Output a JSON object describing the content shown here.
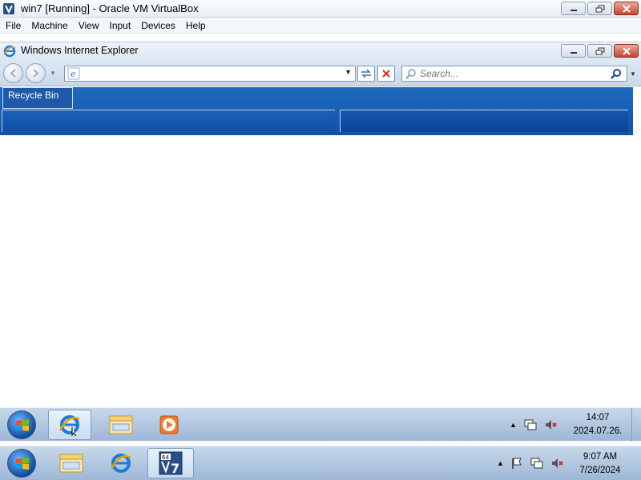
{
  "vbox": {
    "title": "win7 [Running] - Oracle VM VirtualBox",
    "menu": [
      {
        "label": "File"
      },
      {
        "label": "Machine"
      },
      {
        "label": "View"
      },
      {
        "label": "Input"
      },
      {
        "label": "Devices"
      },
      {
        "label": "Help"
      }
    ]
  },
  "ie": {
    "title": "Windows Internet Explorer",
    "address_value": "",
    "search_placeholder": "Search..."
  },
  "desktop": {
    "recycle_bin_label": "Recycle Bin"
  },
  "guest_taskbar": {
    "items": [
      "internet-explorer",
      "windows-explorer",
      "media-player"
    ],
    "active_item": "internet-explorer",
    "clock_time": "14:07",
    "clock_date": "2024.07.26."
  },
  "host_taskbar": {
    "items": [
      "windows-explorer",
      "internet-explorer",
      "virtualbox-win7-64"
    ],
    "active_item": "virtualbox-win7-64",
    "clock_time": "9:07 AM",
    "clock_date": "7/26/2024"
  },
  "colors": {
    "desktop_blue": "#1f6ac0",
    "taskbar": "#b3c9e2",
    "close_red": "#c6452d"
  }
}
